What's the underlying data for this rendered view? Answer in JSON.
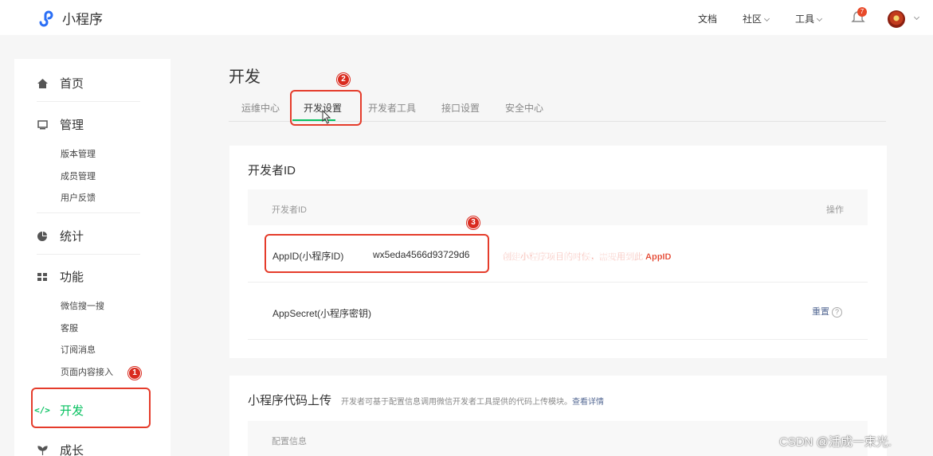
{
  "header": {
    "logo_text": "小程序",
    "nav": {
      "docs": "文档",
      "community": "社区",
      "tools": "工具"
    },
    "notification_count": "7",
    "colors": {
      "brand": "#07c160",
      "logo": "#2a6ef5",
      "link": "#576b95"
    }
  },
  "sidebar": {
    "home": "首页",
    "manage": "管理",
    "manage_items": [
      "版本管理",
      "成员管理",
      "用户反馈"
    ],
    "stats": "统计",
    "features": "功能",
    "feature_items": [
      "微信搜一搜",
      "客服",
      "订阅消息",
      "页面内容接入"
    ],
    "develop": "开发",
    "growth": "成长"
  },
  "main": {
    "title": "开发",
    "tabs": [
      "运维中心",
      "开发设置",
      "开发者工具",
      "接口设置",
      "安全中心"
    ],
    "active_tab": "开发设置",
    "dev_id_card": {
      "title": "开发者ID",
      "col_left": "开发者ID",
      "col_right": "操作",
      "appid_label": "AppID(小程序ID)",
      "appid_value": "wx5eda4566d93729d6",
      "secret_label": "AppSecret(小程序密钥)",
      "reset_label": "重置",
      "help_glyph": "?"
    },
    "upload_card": {
      "title": "小程序代码上传",
      "subtitle": "开发者可基于配置信息调用微信开发者工具提供的代码上传模块。",
      "detail_link": "查看详情",
      "col_left": "配置信息"
    }
  },
  "annotations": {
    "step1": "1",
    "step2": "2",
    "step3": "3",
    "note": "创建小程序项目的时候，需要用到此 AppID",
    "color": "#e53c2b"
  },
  "watermark": "CSDN @活成一束光."
}
